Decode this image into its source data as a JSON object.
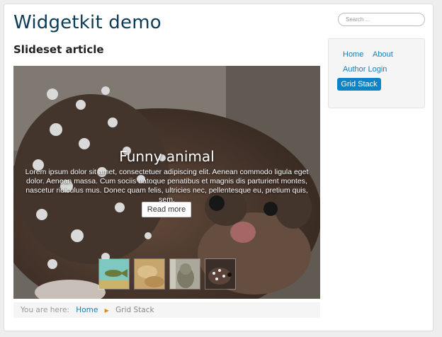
{
  "site": {
    "title": "Widgetkit demo"
  },
  "article": {
    "title": "Slideset article"
  },
  "slideshow": {
    "heading": "Funny animal",
    "text": "Lorem ipsum dolor sit amet, consectetuer adipiscing elit. Aenean commodo ligula eget dolor. Aenean massa. Cum sociis natoque penatibus et magnis dis parturient montes, nascetur ridiculus mus. Donec quam felis, ultricies nec, pellentesque eu, pretium quis, sem.",
    "read_more": "Read more",
    "thumbnails": [
      "thumbnail-fish",
      "thumbnail-sand",
      "thumbnail-animal",
      "thumbnail-quoll"
    ]
  },
  "breadcrumb": {
    "label": "You are here:",
    "home": "Home",
    "current": "Grid Stack"
  },
  "search": {
    "placeholder": "Search ..."
  },
  "menu": {
    "home": "Home",
    "about": "About",
    "author_login": "Author Login",
    "active": "Grid Stack"
  },
  "colors": {
    "title": "#0b3b58",
    "link": "#1a7cb8",
    "active_nav": "#0f83c8",
    "separator": "#e08a1a"
  }
}
